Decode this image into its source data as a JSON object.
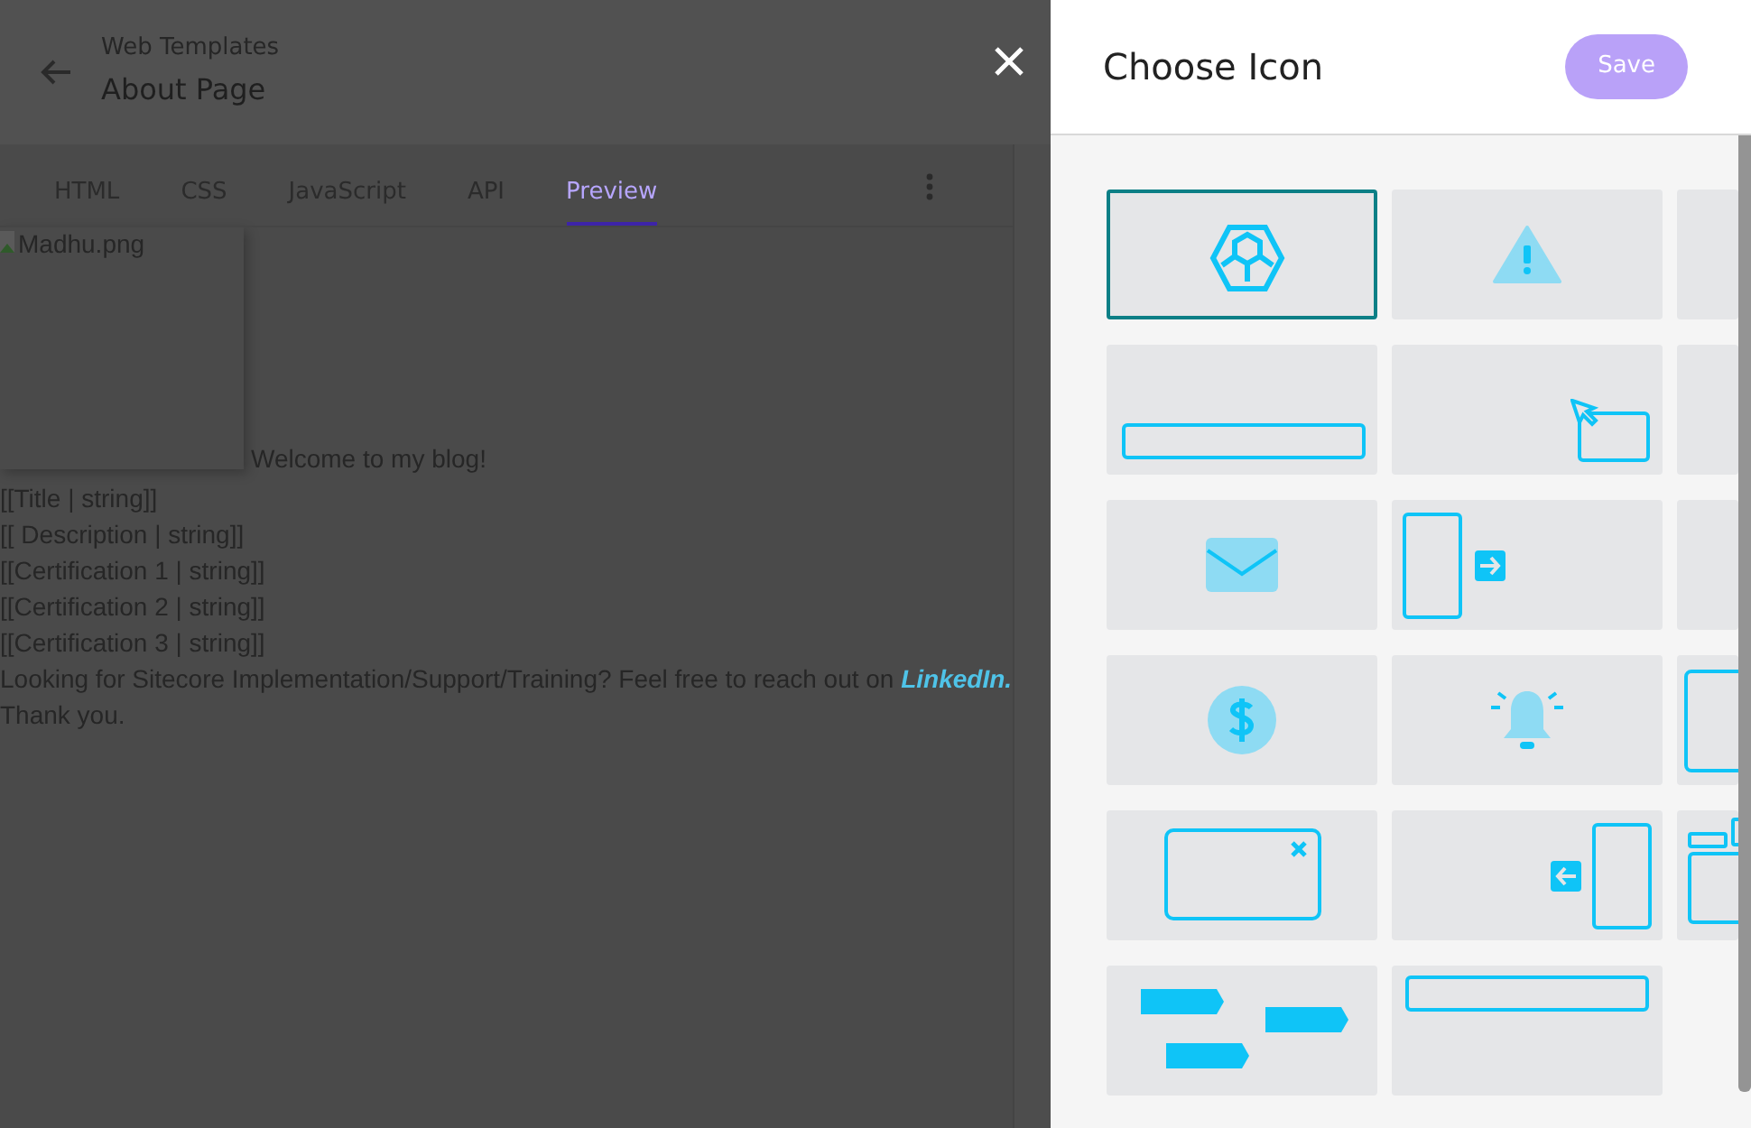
{
  "header": {
    "breadcrumb": "Web Templates",
    "title": "About Page"
  },
  "tabs": [
    {
      "label": "HTML",
      "selected": false
    },
    {
      "label": "CSS",
      "selected": false
    },
    {
      "label": "JavaScript",
      "selected": false
    },
    {
      "label": "API",
      "selected": false
    },
    {
      "label": "Preview",
      "selected": true
    }
  ],
  "preview": {
    "image_alt": "Madhu.png",
    "welcome": "Welcome to my blog!",
    "lines": [
      "[[Title | string]]",
      "[[ Description | string]]",
      "[[Certification 1 | string]]",
      "[[Certification 2 | string]]",
      "[[Certification 3 | string]]"
    ],
    "closing": "Looking for Sitecore Implementation/Support/Training? Feel free to reach out on",
    "link": "LinkedIn.",
    "thanks": "Thank you."
  },
  "drawer": {
    "title": "Choose Icon",
    "save_button": "Save"
  },
  "icons": [
    {
      "kind": "hexagon",
      "selected": true
    },
    {
      "kind": "warning",
      "selected": false
    },
    {
      "kind": "blank",
      "selected": false
    },
    {
      "kind": "bar-bottom",
      "selected": false
    },
    {
      "kind": "cursor-box",
      "selected": false
    },
    {
      "kind": "blank",
      "selected": false
    },
    {
      "kind": "mail",
      "selected": false
    },
    {
      "kind": "panel-right",
      "selected": false
    },
    {
      "kind": "blank",
      "selected": false
    },
    {
      "kind": "dollar",
      "selected": false
    },
    {
      "kind": "bell",
      "selected": false
    },
    {
      "kind": "panel-edge",
      "selected": false
    },
    {
      "kind": "modal",
      "selected": false
    },
    {
      "kind": "panel-left",
      "selected": false
    },
    {
      "kind": "layout",
      "selected": false
    },
    {
      "kind": "tags",
      "selected": false
    },
    {
      "kind": "bar-top",
      "selected": false
    }
  ]
}
